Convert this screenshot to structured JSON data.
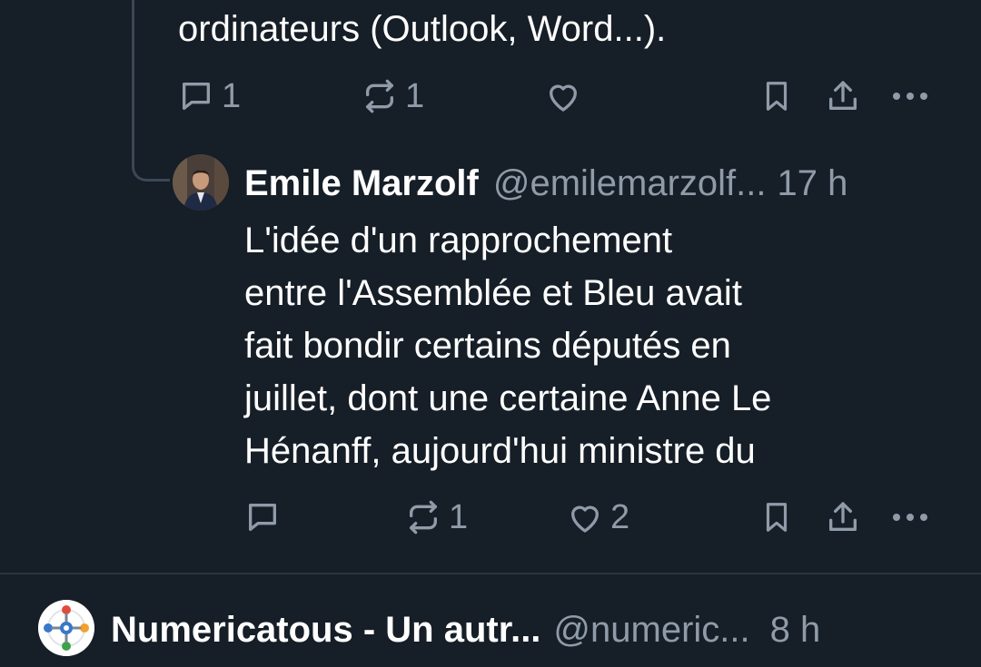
{
  "previous_post": {
    "text_tail": "ordinateurs (Outlook, Word...).",
    "actions": {
      "reply_count": "1",
      "repost_count": "1",
      "like_count": ""
    },
    "icons": [
      "reply-icon",
      "repost-icon",
      "like-icon",
      "bookmark-icon",
      "share-icon",
      "more-icon"
    ]
  },
  "reply_post": {
    "author_name": "Emile Marzolf",
    "handle": "@emilemarzolf...",
    "timestamp": "17 h",
    "lines": [
      "L'idée d'un rapprochement",
      "entre l'Assemblée et Bleu avait",
      "fait bondir certains députés en",
      "juillet, dont une certaine Anne Le",
      "Hénanff, aujourd'hui ministre du"
    ],
    "actions": {
      "reply_count": "",
      "repost_count": "1",
      "like_count": "2"
    }
  },
  "next_post": {
    "author_name": "Numericatous - Un autr...",
    "handle": "@numeric...",
    "timestamp": "8 h"
  },
  "colors": {
    "background": "#161e27",
    "text_primary": "#ffffff",
    "text_secondary": "#8f9ba8",
    "thread_line": "#3b4856",
    "divider": "#2a3440"
  }
}
